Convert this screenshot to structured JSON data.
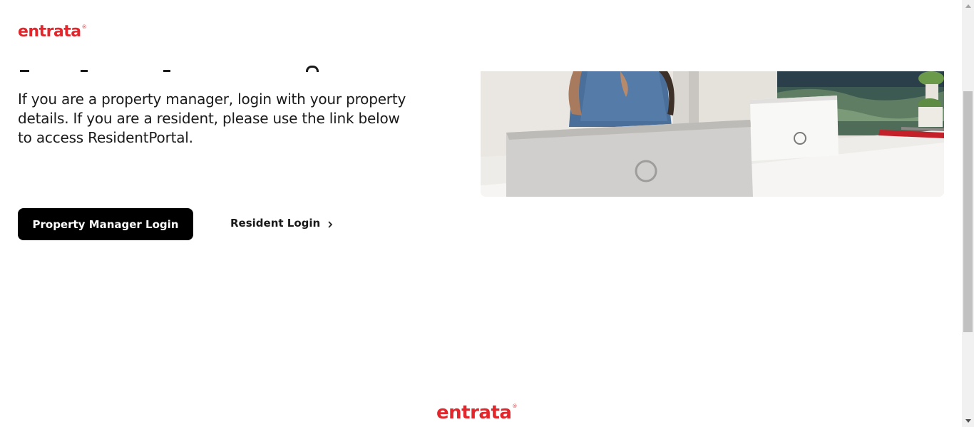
{
  "brand": {
    "logo_text": "entrata",
    "registered_mark": "®",
    "color": "#e3262b"
  },
  "intro": {
    "text": "If you are a property manager, login with your property details. If you are a resident, please use the link below to access ResidentPortal."
  },
  "actions": {
    "property_manager_label": "Property Manager Login",
    "resident_label": "Resident Login",
    "resident_icon": "chevron-right-icon"
  },
  "footer": {
    "logo_text": "entrata",
    "registered_mark": "®"
  },
  "scrollbar": {
    "up_icon": "scroll-up-arrow-icon",
    "down_icon": "scroll-down-arrow-icon"
  }
}
